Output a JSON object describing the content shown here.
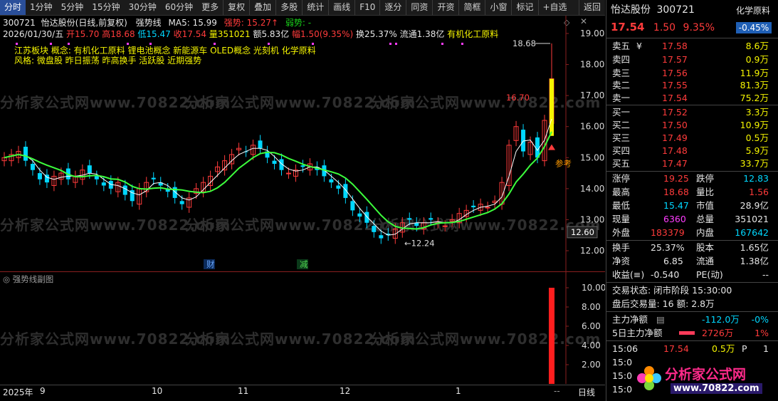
{
  "toolbar": {
    "tabs": [
      "分时",
      "1分钟",
      "5分钟",
      "15分钟",
      "30分钟",
      "60分钟",
      "更多"
    ],
    "menus": [
      "复权",
      "叠加",
      "多股",
      "统计",
      "画线",
      "F10",
      "逐分",
      "同资",
      "开资",
      "简框",
      "小窗",
      "标记",
      "+自选",
      "返回"
    ]
  },
  "chart_header": {
    "code": "300721",
    "name_period": "怡达股份(日线,前复权)",
    "indicator": "强势线",
    "ma_label": "MA5: 15.99",
    "strong_label": "强势: 15.27",
    "weak_label": "弱势: -"
  },
  "ohlc_line": {
    "date": "2026/01/30/五",
    "open_label": "开15.70",
    "high_label": "高18.68",
    "low_label": "低15.47",
    "close_label": "收17.54",
    "volume_label": "量351021",
    "amount_label": "额5.83亿",
    "change_label": "幅1.50(9.35%)",
    "turnover_label": "换25.37%",
    "float_label": "流通1.38亿",
    "concept_label": "有机化工原料"
  },
  "concept_rows": {
    "row1": "江苏板块  概念: 有机化工原料   锂电池概念 新能源车 OLED概念 光刻机 化学原料",
    "row2": "风格:  微盘股 昨日振荡 昨高换手 活跃股 近期强势"
  },
  "annotations": {
    "high_peak": "18.68",
    "high_mid": "16.70",
    "low_mark": "12.24",
    "current_price_tag": "12.60",
    "ref_label": "参考",
    "fin_marker": "财",
    "cut_marker": "减"
  },
  "sub_chart": {
    "title": "强势线副图",
    "y_ticks": [
      "10.00",
      "8.00",
      "6.00",
      "4.00",
      "2.00"
    ],
    "bar_value": 10.0
  },
  "x_axis": {
    "labels": [
      "2025年",
      "9",
      "10",
      "11",
      "12",
      "1"
    ],
    "period": "日线",
    "dash": "--"
  },
  "chart_data": {
    "type": "candlestick",
    "y_ticks": [
      19.0,
      18.0,
      17.0,
      16.0,
      15.0,
      14.0,
      13.0,
      12.0
    ],
    "ylim": [
      11.6,
      19.4
    ],
    "closes": [
      15.0,
      15.1,
      15.2,
      14.9,
      14.6,
      14.3,
      14.2,
      14.4,
      14.5,
      14.3,
      14.4,
      14.6,
      14.5,
      14.3,
      14.1,
      14.0,
      14.2,
      13.8,
      13.6,
      14.0,
      14.2,
      14.3,
      14.1,
      13.9,
      13.7,
      13.5,
      13.7,
      14.0,
      14.2,
      14.4,
      14.7,
      14.9,
      15.1,
      15.3,
      15.2,
      15.4,
      15.3,
      15.0,
      14.8,
      14.6,
      14.5,
      14.6,
      14.7,
      14.8,
      14.6,
      14.4,
      14.2,
      14.0,
      13.7,
      13.3,
      13.1,
      12.9,
      12.6,
      12.4,
      12.5,
      12.7,
      12.9,
      13.0,
      12.8,
      12.9,
      13.0,
      12.9,
      12.8,
      13.0,
      13.2,
      13.3,
      13.4,
      13.5,
      13.4,
      13.6,
      14.2,
      15.4,
      16.0,
      15.2,
      15.5,
      15.0,
      16.2,
      17.54
    ],
    "series": [
      {
        "name": "MA5"
      },
      {
        "name": "强势"
      }
    ]
  },
  "quote_panel": {
    "name": "怡达股份",
    "code": "300721",
    "tag": "化学原料",
    "price": "17.54",
    "change": "1.50",
    "pct": "9.35%",
    "tag_pct": "-0.45%",
    "asks": [
      {
        "label": "卖五",
        "flag": "¥",
        "price": "17.58",
        "vol": "8.6万"
      },
      {
        "label": "卖四",
        "flag": "",
        "price": "17.57",
        "vol": "0.9万"
      },
      {
        "label": "卖三",
        "flag": "",
        "price": "17.56",
        "vol": "11.9万"
      },
      {
        "label": "卖二",
        "flag": "",
        "price": "17.55",
        "vol": "81.3万"
      },
      {
        "label": "卖一",
        "flag": "",
        "price": "17.54",
        "vol": "75.2万"
      }
    ],
    "bids": [
      {
        "label": "买一",
        "price": "17.52",
        "vol": "3.3万"
      },
      {
        "label": "买二",
        "price": "17.50",
        "vol": "10.9万"
      },
      {
        "label": "买三",
        "price": "17.49",
        "vol": "0.5万"
      },
      {
        "label": "买四",
        "price": "17.48",
        "vol": "5.9万"
      },
      {
        "label": "买五",
        "price": "17.47",
        "vol": "33.7万"
      }
    ],
    "stats": [
      {
        "k1": "涨停",
        "v1": "19.25",
        "k2": "跌停",
        "v2": "12.83"
      },
      {
        "k1": "最高",
        "v1": "18.68",
        "k2": "量比",
        "v2": "1.56"
      },
      {
        "k1": "最低",
        "v1": "15.47",
        "k2": "市值",
        "v2": "28.9亿"
      },
      {
        "k1": "现量",
        "v1": "6360",
        "k2": "总量",
        "v2": "351021"
      },
      {
        "k1": "外盘",
        "v1": "183379",
        "k2": "内盘",
        "v2": "167642"
      }
    ],
    "stats2": [
      {
        "k1": "换手",
        "v1": "25.37%",
        "k2": "股本",
        "v2": "1.65亿"
      },
      {
        "k1": "净资",
        "v1": "6.85",
        "k2": "流通",
        "v2": "1.38亿"
      },
      {
        "k1": "收益(≡)",
        "v1": "-0.540",
        "k2": "PE(动)",
        "v2": "--"
      }
    ],
    "trade_state": "交易状态: 闭市阶段 15:30:00",
    "after_hours": "盘后交易量: 16  额: 2.8万",
    "main_net_label": "主力净额",
    "main_net_value": "-112.0万",
    "main_net_pct": "-0%",
    "five_day_label": "5日主力净额",
    "five_day_value": "2726万",
    "five_day_pct": "1%",
    "ticks": [
      {
        "time": "15:06",
        "price": "17.54",
        "vol": "0.5万",
        "side": "P",
        "count": "1"
      },
      {
        "time": "15:0",
        "price": "",
        "vol": "",
        "side": "",
        "count": ""
      },
      {
        "time": "15:0",
        "price": "",
        "vol": "",
        "side": "",
        "count": ""
      },
      {
        "time": "15:0",
        "price": "",
        "vol": "",
        "side": "",
        "count": ""
      }
    ]
  },
  "logo": {
    "text": "分析家公式网",
    "url": "www.70822.com"
  },
  "watermark": "分析家公式网www.70822.com"
}
